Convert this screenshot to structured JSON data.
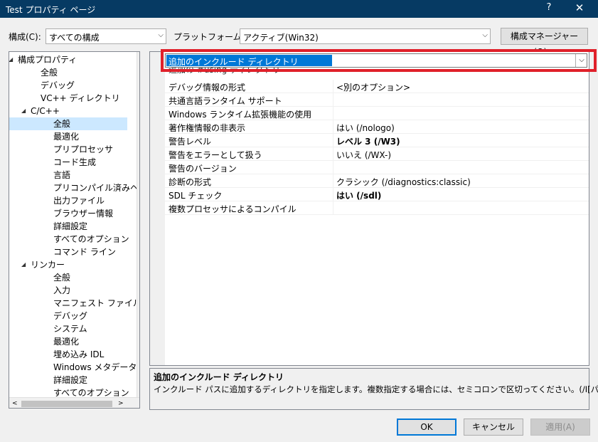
{
  "window": {
    "title": "Test プロパティ ページ",
    "help": "?",
    "close": "✕"
  },
  "toolbar": {
    "config_label": "構成(C):",
    "config_value": "すべての構成",
    "platform_label": "プラットフォーム(P):",
    "platform_value": "アクティブ(Win32)",
    "config_manager_label": "構成マネージャー(O)..."
  },
  "tree": {
    "items": [
      {
        "label": "構成プロパティ",
        "expander": "◢"
      },
      {
        "label": "全般"
      },
      {
        "label": "デバッグ"
      },
      {
        "label": "VC++ ディレクトリ"
      },
      {
        "label": "C/C++",
        "expander": "◢"
      },
      {
        "label": "全般"
      },
      {
        "label": "最適化"
      },
      {
        "label": "プリプロセッサ"
      },
      {
        "label": "コード生成"
      },
      {
        "label": "言語"
      },
      {
        "label": "プリコンパイル済みヘッ"
      },
      {
        "label": "出力ファイル"
      },
      {
        "label": "ブラウザー情報"
      },
      {
        "label": "詳細設定"
      },
      {
        "label": "すべてのオプション"
      },
      {
        "label": "コマンド ライン"
      },
      {
        "label": "リンカー",
        "expander": "◢"
      },
      {
        "label": "全般"
      },
      {
        "label": "入力"
      },
      {
        "label": "マニフェスト ファイル"
      },
      {
        "label": "デバッグ"
      },
      {
        "label": "システム"
      },
      {
        "label": "最適化"
      },
      {
        "label": "埋め込み IDL"
      },
      {
        "label": "Windows メタデータ"
      },
      {
        "label": "詳細設定"
      },
      {
        "label": "すべてのオプション"
      }
    ]
  },
  "grid": {
    "editing": {
      "name": "追加のインクルード ディレクトリ",
      "value": ""
    },
    "partial_row": "追加の #using ディレクトリ",
    "rows": [
      {
        "name": "デバッグ情報の形式",
        "value": "<別のオプション>",
        "bold": false
      },
      {
        "name": "共通言語ランタイム サポート",
        "value": "",
        "bold": false
      },
      {
        "name": "Windows ランタイム拡張機能の使用",
        "value": "",
        "bold": false
      },
      {
        "name": "著作権情報の非表示",
        "value": "はい (/nologo)",
        "bold": false
      },
      {
        "name": "警告レベル",
        "value": "レベル 3 (/W3)",
        "bold": true
      },
      {
        "name": "警告をエラーとして扱う",
        "value": "いいえ (/WX-)",
        "bold": false
      },
      {
        "name": "警告のバージョン",
        "value": "",
        "bold": false
      },
      {
        "name": "診断の形式",
        "value": "クラシック (/diagnostics:classic)",
        "bold": false
      },
      {
        "name": "SDL チェック",
        "value": "はい (/sdl)",
        "bold": true
      },
      {
        "name": "複数プロセッサによるコンパイル",
        "value": "",
        "bold": false
      }
    ]
  },
  "description": {
    "title": "追加のインクルード ディレクトリ",
    "text": "インクルード パスに追加するディレクトリを指定します。複数指定する場合には、セミコロンで区切ってください。(/I[パス])"
  },
  "buttons": {
    "ok": "OK",
    "cancel": "キャンセル",
    "apply": "適用(A)"
  },
  "colors": {
    "titlebar": "#063a63",
    "selection": "#0078d7",
    "highlight_box": "#e0202a"
  }
}
